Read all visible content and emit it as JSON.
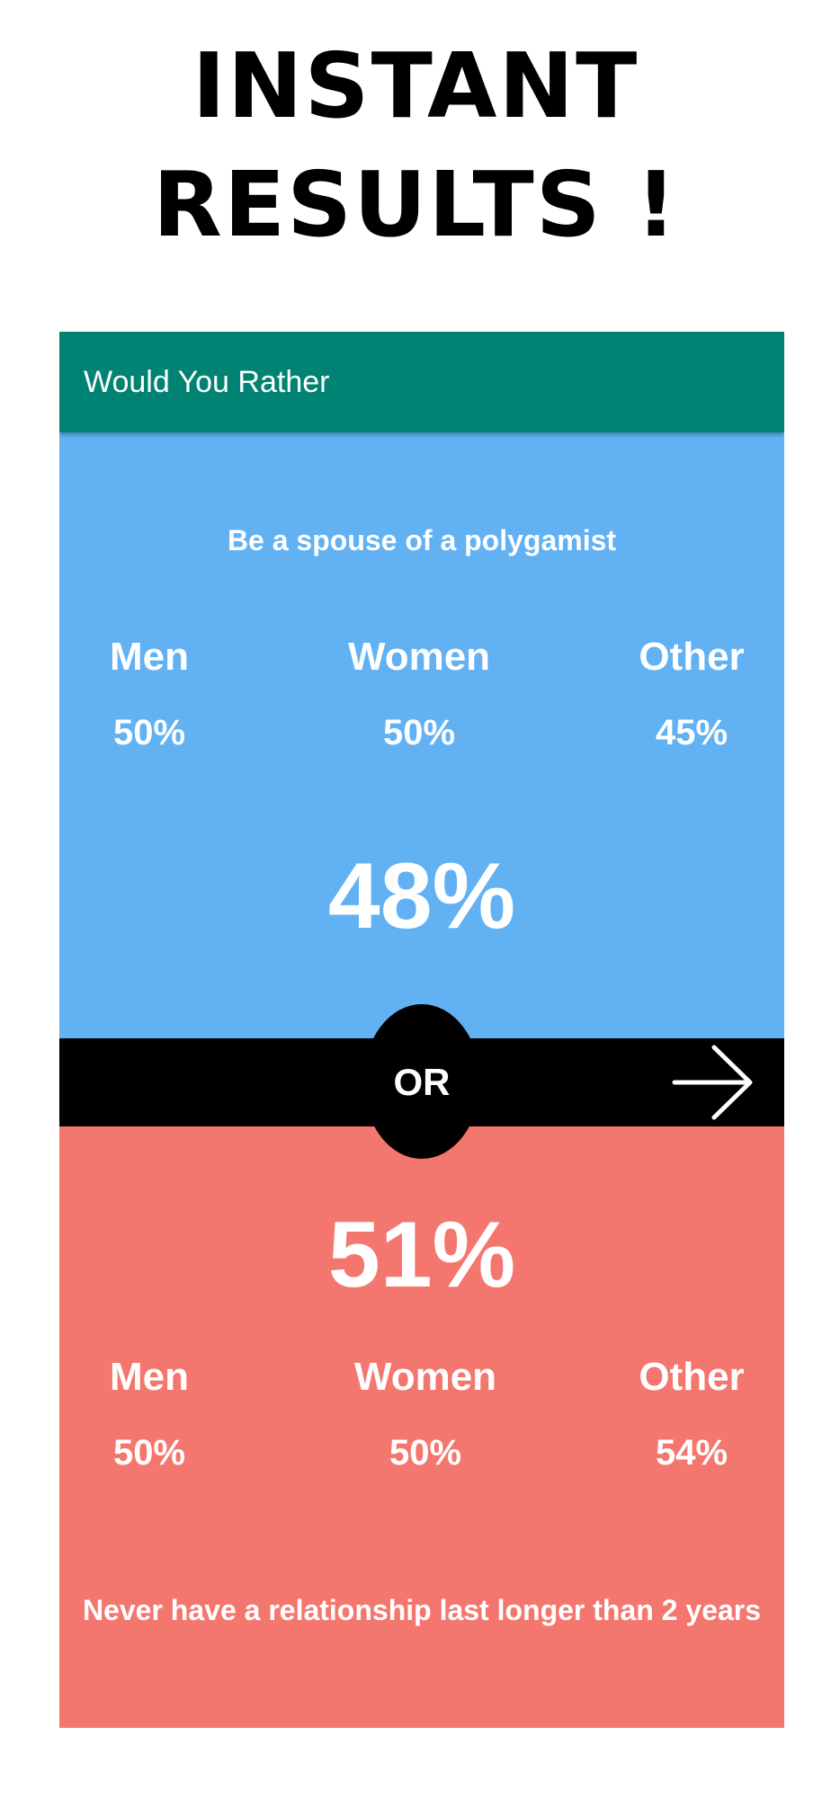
{
  "headline": {
    "line1": "INSTANT",
    "line2": "RESULTS !"
  },
  "app": {
    "title": "Would You Rather"
  },
  "option_a": {
    "text": "Be a spouse of a polygamist",
    "overall_pct": "48%",
    "stats": [
      {
        "label": "Men",
        "value": "50%"
      },
      {
        "label": "Women",
        "value": "50%"
      },
      {
        "label": "Other",
        "value": "45%"
      }
    ]
  },
  "separator": {
    "label": "OR",
    "next_icon": "arrow-right-icon"
  },
  "option_b": {
    "text": "Never have a relationship last longer than 2 years",
    "overall_pct": "51%",
    "stats": [
      {
        "label": "Men",
        "value": "50%"
      },
      {
        "label": "Women",
        "value": "50%"
      },
      {
        "label": "Other",
        "value": "54%"
      }
    ]
  },
  "colors": {
    "appbar": "#008373",
    "option_a_bg": "#61b1f3",
    "option_b_bg": "#f4776f",
    "separator_bg": "#000000",
    "text": "#ffffff"
  }
}
